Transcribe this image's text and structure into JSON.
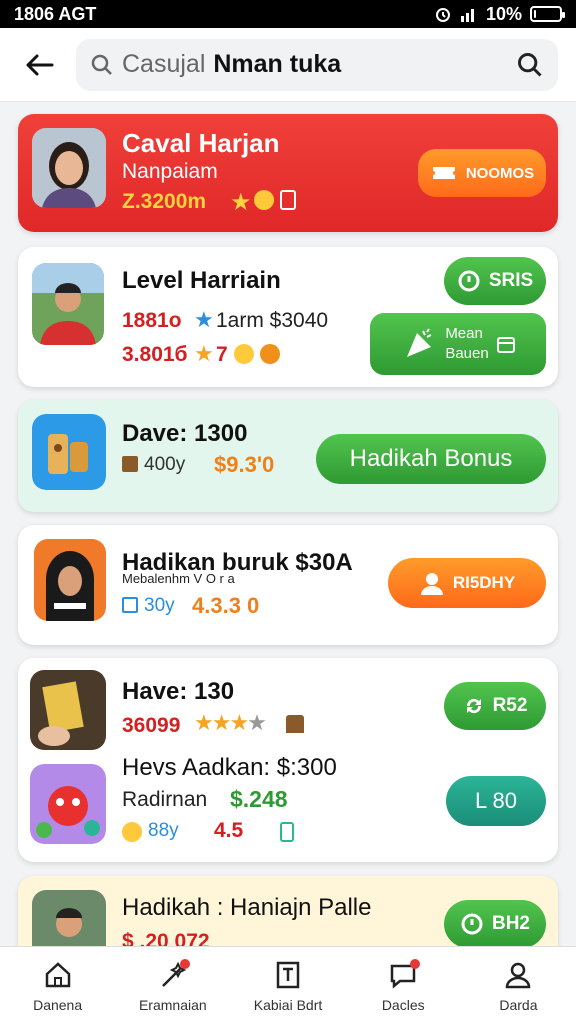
{
  "status": {
    "time": "1806 AGT",
    "battery": "10%",
    "battery_level": 0.1
  },
  "search": {
    "placeholder": "Casujal",
    "value": "Nman tuka"
  },
  "cards": [
    {
      "title": "Caval Harjan",
      "subtitle": "Nanpaiam",
      "meta": "Z.3200m",
      "action": "NOOMOS"
    },
    {
      "title": "Level Harriain",
      "line1_red": "1881o",
      "line1_rest": "1arm $3040",
      "line2_red": "3.801б",
      "line2_num": "7",
      "action1": "SRIS",
      "action2_line1": "Mean",
      "action2_line2": "Bauen"
    },
    {
      "title": "Dave: 1300",
      "meta1": "400y",
      "meta2": "$9.3'0",
      "action": "Hadikah Bonus"
    },
    {
      "title": "Hadikan buruk $30A",
      "subtitle": "Mebalenhm V O r a",
      "meta1": "30y",
      "meta2": "4.3.3 0",
      "action": "RI5DHY"
    },
    {
      "title": "Have: 130",
      "line1_red": "36099",
      "action1": "R52",
      "title2": "Hevs Aadkan: $:300",
      "line2_label": "Radirnan",
      "line2_value": "$.248",
      "line3_a": "88y",
      "line3_b": "4.5",
      "action2": "L 80"
    },
    {
      "title": "Hadikah : Haniajn Palle",
      "line1": "$ .20 072",
      "action": "BH2"
    }
  ],
  "nav": [
    "Danena",
    "Eramnaian",
    "Kabiai Bdrt",
    "Dacles",
    "Darda"
  ],
  "colors": {
    "accent_red": "#e8302e",
    "accent_green": "#2e9a33",
    "accent_orange": "#ff7a1f",
    "mint": "#e3f6ee",
    "cream": "#fff6da"
  }
}
